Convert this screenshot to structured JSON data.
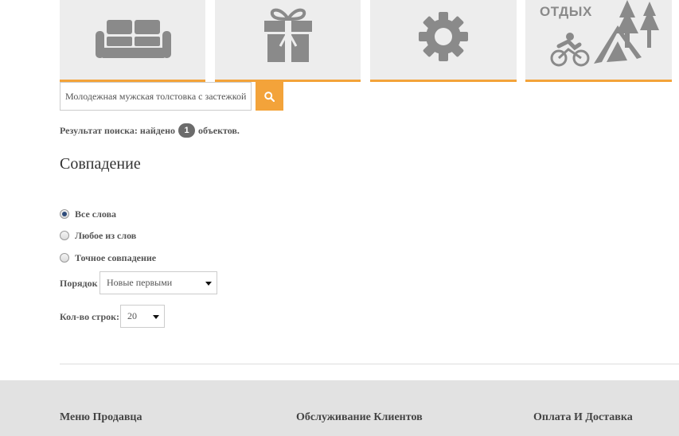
{
  "categories": [
    {
      "label": "",
      "icon": "sofa-icon"
    },
    {
      "label": "",
      "icon": "gift-icon"
    },
    {
      "label": "",
      "icon": "gear-icon"
    },
    {
      "label": "ОТДЫХ",
      "icon": "outdoor-icon"
    }
  ],
  "search": {
    "value": "Молодежная мужская толстовка с застежкой",
    "placeholder": ""
  },
  "result": {
    "prefix": "Результат поиска: найдено",
    "count": "1",
    "suffix": "объектов."
  },
  "match": {
    "title": "Совпадение",
    "options": [
      {
        "label": "Все слова",
        "checked": true
      },
      {
        "label": "Любое из слов",
        "checked": false
      },
      {
        "label": "Точное совпадение",
        "checked": false
      }
    ]
  },
  "order": {
    "label": "Порядок",
    "value": "Новые первыми"
  },
  "rows": {
    "label": "Кол-во строк:",
    "value": "20"
  },
  "footer": {
    "headings": [
      "Меню Продавца",
      "Обслуживание Клиентов",
      "Оплата И Доставка"
    ]
  },
  "colors": {
    "accent": "#f3a33a",
    "tile": "#ededed",
    "icon": "#8a8a8a"
  }
}
